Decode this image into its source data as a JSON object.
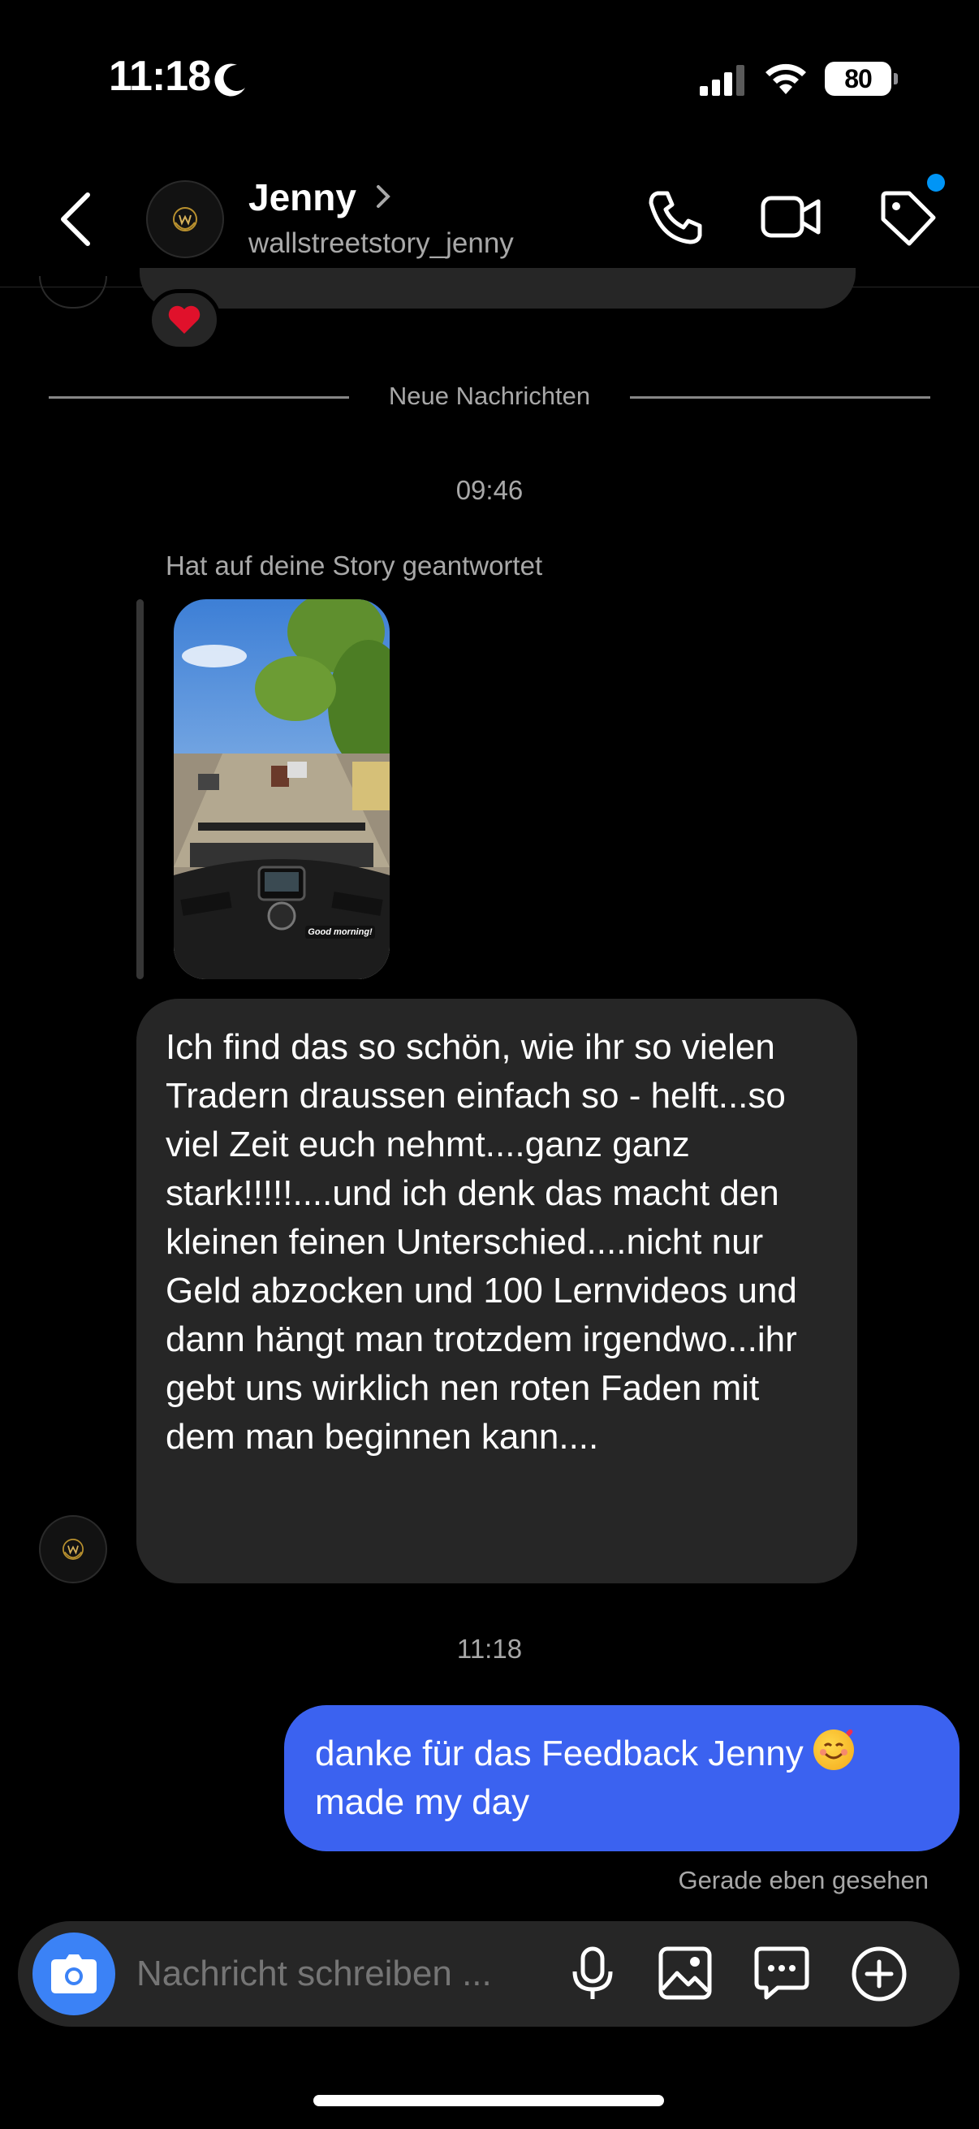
{
  "status": {
    "time": "11:18",
    "battery": "80"
  },
  "header": {
    "name": "Jenny",
    "username": "wallstreetstory_jenny"
  },
  "chat": {
    "divider_label": "Neue Nachrichten",
    "time_1": "09:46",
    "story_caption": "Hat auf deine Story geantwortet",
    "story_overlay": "Good morning!",
    "incoming_message": "Ich find das so schön, wie ihr so vielen Tradern draussen einfach so - helft...so viel Zeit euch nehmt....ganz ganz stark!!!!!....und ich denk das macht den kleinen feinen Unterschied....nicht nur Geld abzocken und 100 Lernvideos und dann hängt man trotzdem irgendwo...ihr gebt uns wirklich nen roten Faden mit dem man beginnen kann....",
    "time_2": "11:18",
    "outgoing_message_line1": "danke für das Feedback Jenny",
    "outgoing_message_line2": "made my day",
    "seen_status": "Gerade eben gesehen"
  },
  "composer": {
    "placeholder": "Nachricht schreiben ..."
  },
  "colors": {
    "outgoing_bubble": "#3b62f0",
    "incoming_bubble": "#262626",
    "accent_dot": "#0095f6"
  }
}
